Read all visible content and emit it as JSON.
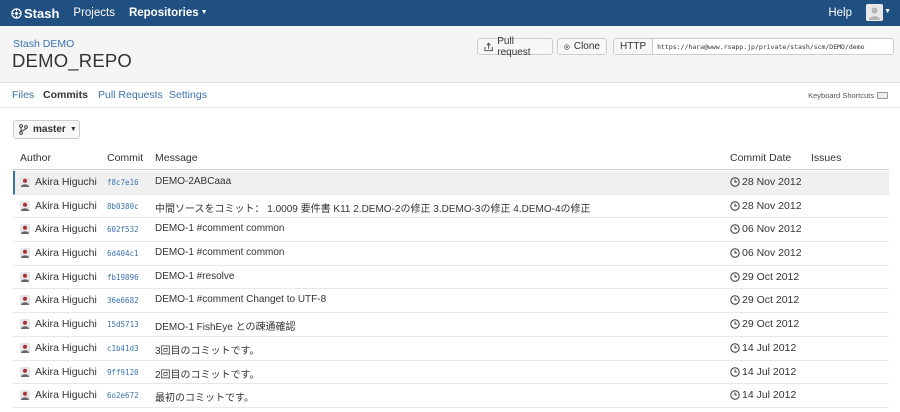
{
  "nav": {
    "logo": "Stash",
    "projects": "Projects",
    "repositories": "Repositories",
    "help": "Help"
  },
  "header": {
    "project": "Stash DEMO",
    "repo": "DEMO_REPO",
    "pull_request": "Pull request",
    "clone": "Clone",
    "http": "HTTP",
    "clone_url": "https://hara@www.rsapp.jp/private/stash/scm/DEMO/demo"
  },
  "tabs": {
    "files": "Files",
    "commits": "Commits",
    "pull_requests": "Pull Requests",
    "settings": "Settings",
    "keyboard_shortcuts": "Keyboard Shortcuts"
  },
  "branch": "master",
  "table": {
    "headers": {
      "author": "Author",
      "commit": "Commit",
      "message": "Message",
      "date": "Commit Date",
      "issues": "Issues"
    },
    "rows": [
      {
        "author": "Akira Higuchi",
        "hash": "f8c7e16",
        "message": "DEMO-2ABCaaa",
        "date": "28 Nov 2012"
      },
      {
        "author": "Akira Higuchi",
        "hash": "8b0380c",
        "message": "中間ソースをコミット： 1.0009 要件書 K11 2.DEMO-2の修正 3.DEMO-3の修正 4.DEMO-4の修正",
        "date": "28 Nov 2012"
      },
      {
        "author": "Akira Higuchi",
        "hash": "602f532",
        "message": "DEMO-1 #comment common",
        "date": "06 Nov 2012"
      },
      {
        "author": "Akira Higuchi",
        "hash": "6d404c1",
        "message": "DEMO-1 #comment common",
        "date": "06 Nov 2012"
      },
      {
        "author": "Akira Higuchi",
        "hash": "fb19896",
        "message": "DEMO-1 #resolve",
        "date": "29 Oct 2012"
      },
      {
        "author": "Akira Higuchi",
        "hash": "36e6682",
        "message": "DEMO-1 #comment Changet to UTF-8",
        "date": "29 Oct 2012"
      },
      {
        "author": "Akira Higuchi",
        "hash": "15d5713",
        "message": "DEMO-1 FishEye との疎通確認",
        "date": "29 Oct 2012"
      },
      {
        "author": "Akira Higuchi",
        "hash": "c1b41d3",
        "message": "3回目のコミットです。",
        "date": "14 Jul 2012"
      },
      {
        "author": "Akira Higuchi",
        "hash": "9ff9120",
        "message": "2回目のコミットです。",
        "date": "14 Jul 2012"
      },
      {
        "author": "Akira Higuchi",
        "hash": "6o2e672",
        "message": "最初のコミットです。",
        "date": "14 Jul 2012"
      }
    ]
  },
  "colors": {
    "nav_bg": "#205081",
    "link": "#3b73af",
    "header_bg": "#f5f5f5"
  }
}
